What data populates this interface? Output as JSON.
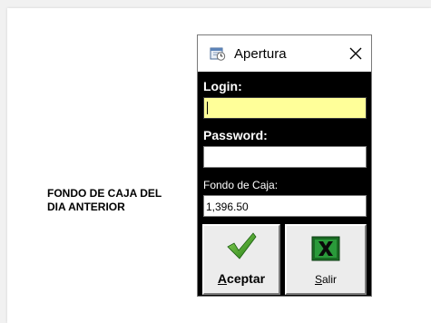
{
  "background_label": {
    "line1": "FONDO DE CAJA DEL",
    "line2": "DIA ANTERIOR"
  },
  "dialog": {
    "title": "Apertura",
    "app_icon": "calendar-clock-icon",
    "close_icon": "close-icon",
    "login": {
      "label": "Login:",
      "value": "",
      "focused": true,
      "bg": "#ffff99"
    },
    "password": {
      "label": "Password:",
      "value": ""
    },
    "fondo": {
      "label": "Fondo de Caja:",
      "value": "1,396.50"
    },
    "buttons": {
      "accept": {
        "label_first": "A",
        "label_rest": "ceptar",
        "icon": "checkmark-icon",
        "color": "#2e8b1e"
      },
      "exit": {
        "label_first": "S",
        "label_rest": "alir",
        "icon": "excel-x-icon",
        "color": "#1a6b24"
      }
    }
  }
}
